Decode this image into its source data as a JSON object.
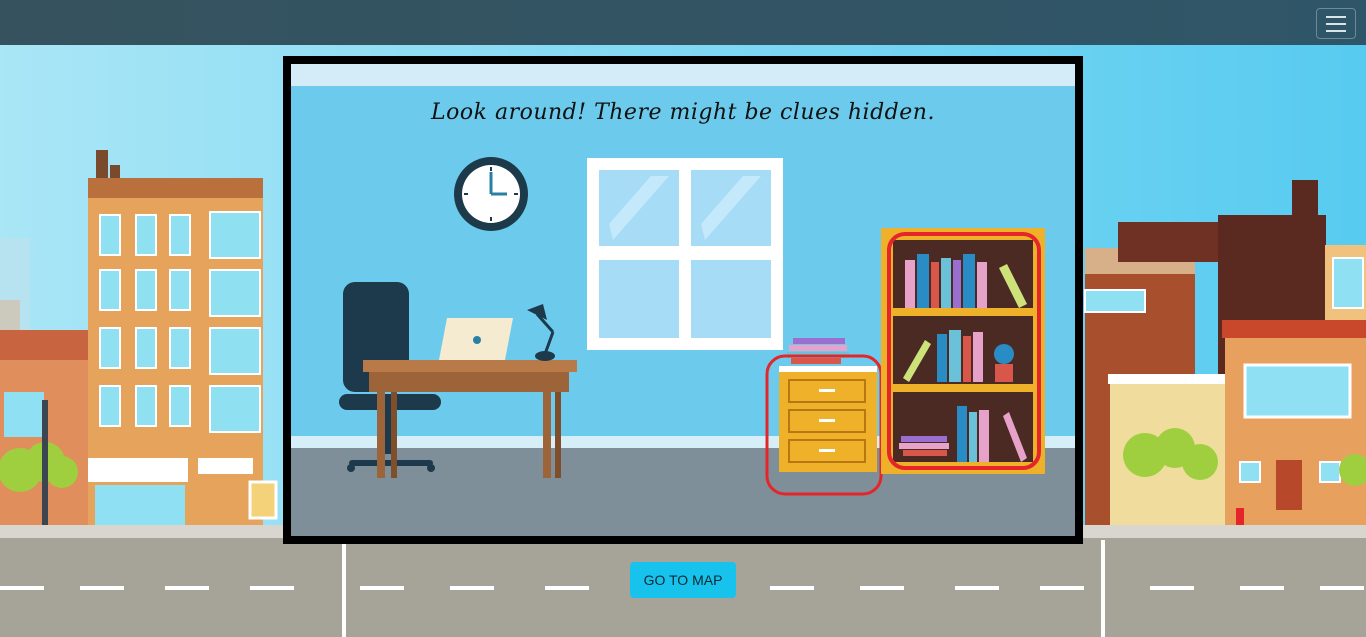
{
  "header": {
    "menu_icon": "hamburger-menu-icon"
  },
  "game": {
    "hint_text": "Look around! There might be clues hidden.",
    "clues": [
      {
        "name": "drawer-cabinet"
      },
      {
        "name": "bookshelf"
      }
    ],
    "highlight_color": "#e4262b"
  },
  "footer": {
    "go_to_map_label": "GO TO MAP"
  },
  "colors": {
    "accent_button": "#17c3ec",
    "topbar": "#2f5668",
    "room_wall": "#6ccbec"
  }
}
